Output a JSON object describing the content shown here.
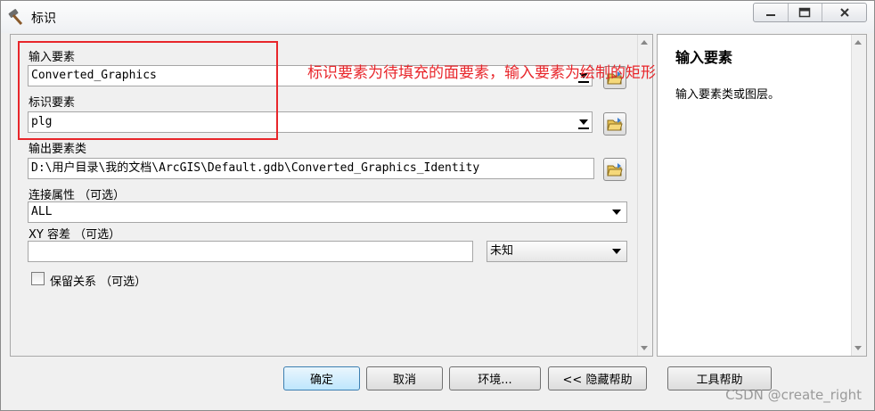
{
  "window": {
    "title": "标识",
    "minimize_icon": "minimize-icon",
    "maximize_icon": "maximize-icon",
    "close_icon": "close-icon"
  },
  "form": {
    "input_features": {
      "label": "输入要素",
      "value": "Converted_Graphics"
    },
    "identity_features": {
      "label": "标识要素",
      "value": "plg"
    },
    "output_feature_class": {
      "label": "输出要素类",
      "value": "D:\\用户目录\\我的文档\\ArcGIS\\Default.gdb\\Converted_Graphics_Identity"
    },
    "join_attributes": {
      "label": "连接属性 （可选）",
      "value": "ALL"
    },
    "xy_tolerance": {
      "label": "XY 容差 （可选）",
      "value": "",
      "unit": "未知"
    },
    "keep_relationships": {
      "label": "保留关系 （可选）",
      "checked": false
    }
  },
  "annotation": {
    "text": "标识要素为待填充的面要素，输入要素为绘制的矩形要素",
    "color": "#e8262b"
  },
  "help": {
    "title": "输入要素",
    "body": "输入要素类或图层。"
  },
  "buttons": {
    "ok": "确定",
    "cancel": "取消",
    "environments": "环境...",
    "hide_help": "<< 隐藏帮助",
    "tool_help": "工具帮助"
  },
  "watermark": "CSDN @create_right"
}
